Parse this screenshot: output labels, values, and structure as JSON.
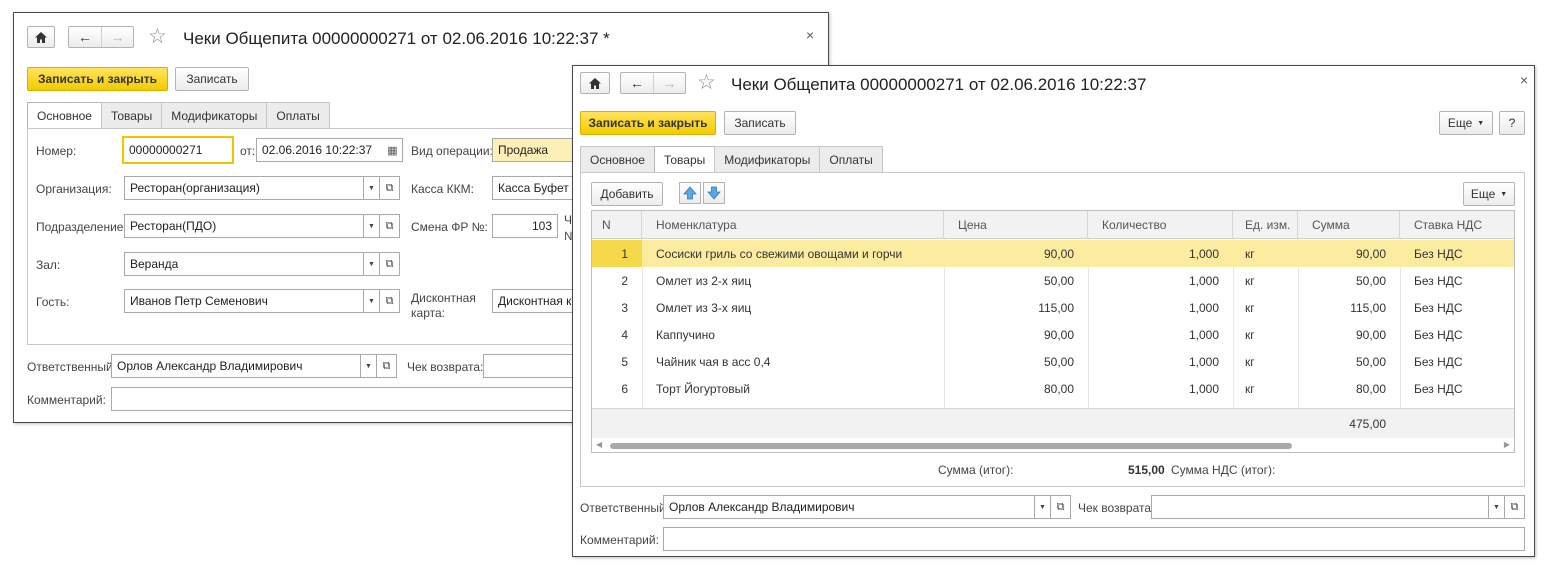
{
  "back_window": {
    "title": "Чеки Общепита 00000000271 от 02.06.2016 10:22:37 *",
    "save_close": "Записать и закрыть",
    "save": "Записать",
    "tabs": [
      "Основное",
      "Товары",
      "Модификаторы",
      "Оплаты"
    ],
    "number_label": "Номер:",
    "number_value": "00000000271",
    "date_label": "от:",
    "date_value": "02.06.2016 10:22:37",
    "org_label": "Организация:",
    "org_value": "Ресторан(организация)",
    "dept_label": "Подразделение:",
    "dept_value": "Ресторан(ПДО)",
    "hall_label": "Зал:",
    "hall_value": "Веранда",
    "guest_label": "Гость:",
    "guest_value": "Иванов Петр Семенович",
    "optype_label": "Вид операции:",
    "optype_value": "Продажа",
    "kkm_label": "Касса ККМ:",
    "kkm_value": "Касса Буфет",
    "shift_label": "Смена ФР №:",
    "shift_value": "103",
    "shift_extra_line1": "Ч",
    "shift_extra_line2": "№",
    "discount_label_line1": "Дисконтная",
    "discount_label_line2": "карта:",
    "discount_value": "Дисконтная ка",
    "responsible_label": "Ответственный:",
    "responsible_value": "Орлов Александр Владимирович",
    "return_label": "Чек возврата:",
    "comment_label": "Комментарий:"
  },
  "front_window": {
    "title": "Чеки Общепита 00000000271 от 02.06.2016 10:22:37",
    "save_close": "Записать и закрыть",
    "save": "Записать",
    "more": "Еще",
    "help": "?",
    "tabs": [
      "Основное",
      "Товары",
      "Модификаторы",
      "Оплаты"
    ],
    "add": "Добавить",
    "more2": "Еще",
    "table": {
      "headers": [
        "N",
        "Номенклатура",
        "Цена",
        "Количество",
        "Ед. изм.",
        "Сумма",
        "Ставка НДС"
      ],
      "rows": [
        [
          "1",
          "Сосиски гриль со свежими овощами и горчи",
          "90,00",
          "1,000",
          "кг",
          "90,00",
          "Без НДС"
        ],
        [
          "2",
          "Омлет из 2-х яиц",
          "50,00",
          "1,000",
          "кг",
          "50,00",
          "Без НДС"
        ],
        [
          "3",
          "Омлет из 3-х яиц",
          "115,00",
          "1,000",
          "кг",
          "115,00",
          "Без НДС"
        ],
        [
          "4",
          "Каппучино",
          "90,00",
          "1,000",
          "кг",
          "90,00",
          "Без НДС"
        ],
        [
          "5",
          "Чайник чая в асс 0,4",
          "50,00",
          "1,000",
          "кг",
          "50,00",
          "Без НДС"
        ],
        [
          "6",
          "Торт Йогуртовый",
          "80,00",
          "1,000",
          "кг",
          "80,00",
          "Без НДС"
        ]
      ],
      "footer_sum": "475,00"
    },
    "total_label": "Сумма (итог):",
    "total_value": "515,00",
    "vat_label": "Сумма НДС (итог):",
    "responsible_label": "Ответственный:",
    "responsible_value": "Орлов Александр Владимирович",
    "return_label": "Чек возврата:",
    "comment_label": "Комментарий:"
  },
  "icons": {
    "home": "home-icon",
    "back": "arrow-left-icon",
    "forward": "arrow-right-icon",
    "favorite": "star-icon",
    "close": "close-icon"
  },
  "colors": {
    "accent_yellow": "#f4cb00",
    "selected_row": "#fbeca0",
    "highlight_field": "#fdf0b6"
  }
}
